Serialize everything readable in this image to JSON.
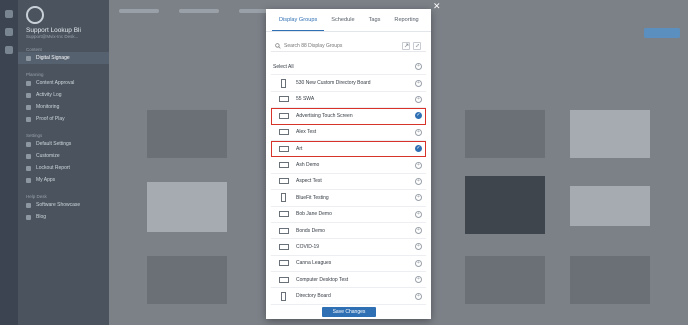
{
  "sidebar": {
    "brand_title": "Support Lookup Bli",
    "brand_sub": "Support@Mvix-Inc Desk...",
    "sections": [
      {
        "label": "Content",
        "items": [
          {
            "label": "Digital Signage"
          }
        ]
      },
      {
        "label": "Planning",
        "items": [
          {
            "label": "Content Approval"
          },
          {
            "label": "Activity Log"
          },
          {
            "label": "Monitoring"
          },
          {
            "label": "Proof of Play"
          }
        ]
      },
      {
        "label": "Settings",
        "items": [
          {
            "label": "Default Settings"
          },
          {
            "label": "Customize"
          },
          {
            "label": "Lockout Report"
          },
          {
            "label": "My Apps"
          }
        ]
      },
      {
        "label": "Help Desk",
        "items": [
          {
            "label": "Software Showcase"
          },
          {
            "label": "Blog"
          }
        ]
      }
    ]
  },
  "modal": {
    "close_icon": "close-icon",
    "tabs": [
      {
        "label": "Display Groups",
        "active": true
      },
      {
        "label": "Schedule",
        "active": false
      },
      {
        "label": "Tags",
        "active": false
      },
      {
        "label": "Reporting",
        "active": false
      }
    ],
    "search_placeholder": "Search 88 Display Groups",
    "select_all_label": "Select All",
    "rows": [
      {
        "label": "530 New Custom Directory Board",
        "orientation": "portrait",
        "checked": false,
        "highlighted": false
      },
      {
        "label": "55 SWA",
        "orientation": "landscape",
        "checked": false,
        "highlighted": false
      },
      {
        "label": "Advertising Touch Screen",
        "orientation": "landscape",
        "checked": true,
        "highlighted": true
      },
      {
        "label": "Alex Test",
        "orientation": "landscape",
        "checked": false,
        "highlighted": false
      },
      {
        "label": "Art",
        "orientation": "landscape",
        "checked": true,
        "highlighted": true
      },
      {
        "label": "Ash Demo",
        "orientation": "landscape",
        "checked": false,
        "highlighted": false
      },
      {
        "label": "Aspect Test",
        "orientation": "landscape",
        "checked": false,
        "highlighted": false
      },
      {
        "label": "BlueFit Testing",
        "orientation": "portrait",
        "checked": false,
        "highlighted": false
      },
      {
        "label": "Bob Jane Demo",
        "orientation": "landscape",
        "checked": false,
        "highlighted": false
      },
      {
        "label": "Bonds Demo",
        "orientation": "landscape",
        "checked": false,
        "highlighted": false
      },
      {
        "label": "COVID-19",
        "orientation": "landscape",
        "checked": false,
        "highlighted": false
      },
      {
        "label": "Canna Leagues",
        "orientation": "landscape",
        "checked": false,
        "highlighted": false
      },
      {
        "label": "Computer Desktop Test",
        "orientation": "landscape",
        "checked": false,
        "highlighted": false
      },
      {
        "label": "Directory Board",
        "orientation": "portrait",
        "checked": false,
        "highlighted": false
      }
    ],
    "save_label": "Save Changes"
  },
  "colors": {
    "accent": "#2f6fb3",
    "highlight": "#d8332b",
    "sidebar": "#4a535e"
  }
}
